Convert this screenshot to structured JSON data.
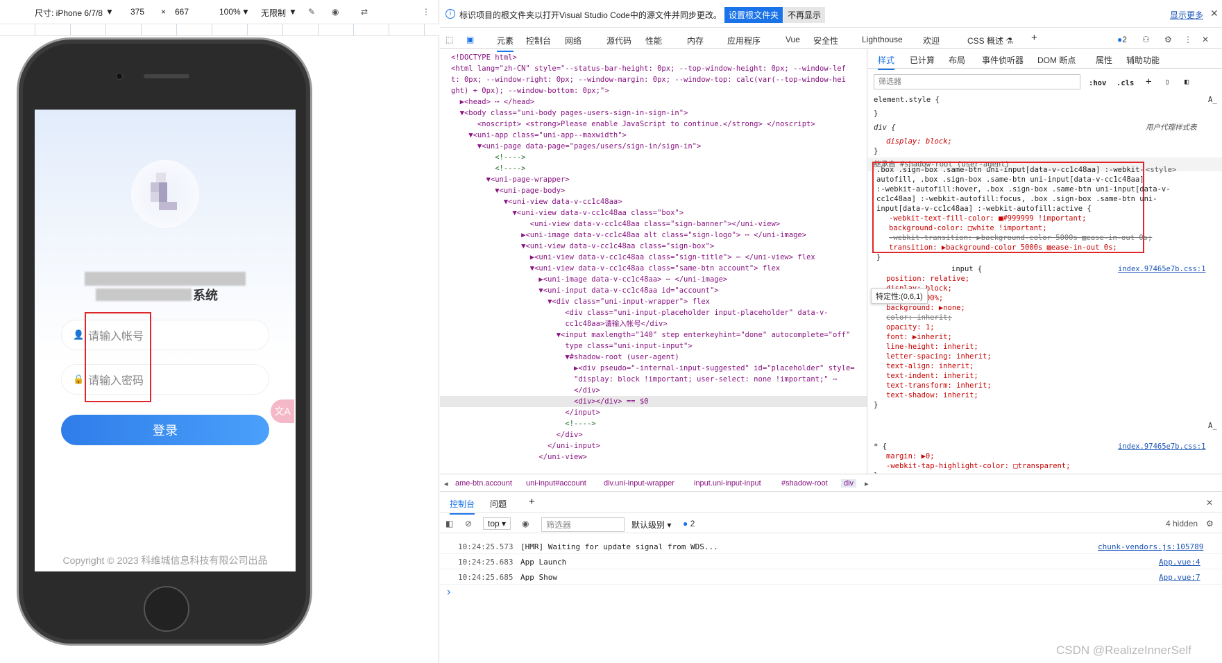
{
  "device_toolbar": {
    "size_label": "尺寸: iPhone 6/7/8",
    "width": "375",
    "times": "×",
    "height": "667",
    "zoom": "100%",
    "throttle": "无限制"
  },
  "app": {
    "system_suffix": "系统",
    "account_placeholder": "请输入帐号",
    "password_placeholder": "请输入密码",
    "login_label": "登录",
    "copyright": "Copyright © 2023 科维城信息科技有限公司出品",
    "translate_label": "文A"
  },
  "infobar": {
    "icon": "i",
    "message": "标识项目的根文件夹以打开Visual Studio Code中的源文件并同步更改。",
    "set_root_button": "设置根文件夹",
    "dismiss_button": "不再显示",
    "show_more": "显示更多",
    "close": "✕"
  },
  "devtools_tabs": [
    "元素",
    "控制台",
    "网络",
    "源代码",
    "性能",
    "内存",
    "应用程序",
    "Vue",
    "安全性",
    "Lighthouse",
    "欢迎",
    "CSS 概述 ⚗"
  ],
  "issues_count": "2",
  "dom_lines": [
    "<!DOCTYPE html>",
    "<html lang=\"zh-CN\" style=\"--status-bar-height: 0px; --top-window-height: 0px; --window-lef",
    "t: 0px; --window-right: 0px; --window-margin: 0px; --window-top: calc(var(--top-window-hei",
    "ght) + 0px); --window-bottom: 0px;\">",
    "  ▶<head> ⋯ </head>",
    "  ▼<body class=\"uni-body pages-users-sign-in-sign-in\">",
    "      <noscript> <strong>Please enable JavaScript to continue.</strong> </noscript>",
    "    ▼<uni-app class=\"uni-app--maxwidth\">",
    "      ▼<uni-page data-page=\"pages/users/sign-in/sign-in\">",
    "          <!---->",
    "          <!---->",
    "        ▼<uni-page-wrapper>",
    "          ▼<uni-page-body>",
    "            ▼<uni-view data-v-cc1c48aa>",
    "              ▼<uni-view data-v-cc1c48aa class=\"box\">",
    "                  <uni-view data-v-cc1c48aa class=\"sign-banner\"></uni-view>",
    "                ▶<uni-image data-v-cc1c48aa alt class=\"sign-logo\"> ⋯ </uni-image>",
    "                ▼<uni-view data-v-cc1c48aa class=\"sign-box\">",
    "                  ▶<uni-view data-v-cc1c48aa class=\"sign-title\"> ⋯ </uni-view> flex",
    "                  ▼<uni-view data-v-cc1c48aa class=\"same-btn account\"> flex",
    "                    ▶<uni-image data-v-cc1c48aa> ⋯ </uni-image>",
    "                    ▼<uni-input data-v-cc1c48aa id=\"account\">",
    "                      ▼<div class=\"uni-input-wrapper\"> flex",
    "                          <div class=\"uni-input-placeholder input-placeholder\" data-v-",
    "                          cc1c48aa>请输入帐号</div>",
    "                        ▼<input maxlength=\"140\" step enterkeyhint=\"done\" autocomplete=\"off\"",
    "                          type class=\"uni-input-input\">",
    "                          ▼#shadow-root (user-agent)",
    "                            ▶<div pseudo=\"-internal-input-suggested\" id=\"placeholder\" style=",
    "                            \"display: block !important; user-select: none !important;\" ⋯",
    "                            </div>",
    "                            <div></div> == $0",
    "                          </input>",
    "                          <!---->",
    "                        </div>",
    "                      </uni-input>",
    "                    </uni-view>"
  ],
  "style_tabs": [
    "样式",
    "已计算",
    "布局",
    "事件侦听器",
    "DOM 断点",
    "属性",
    "辅助功能"
  ],
  "styles": {
    "filter_placeholder": "筛选器",
    "hov": ":hov",
    "cls": ".cls",
    "element_style": "element.style {",
    "close_brace": "}",
    "div_selector": "div {",
    "ua_label": "用户代理样式表",
    "div_display": "display: block;",
    "inherited": "继承自 #shadow-root (user-agent)",
    "autofill_selector": [
      ".box .sign-box .same-btn uni-input[data-v-cc1c48aa] :-webkit-",
      "autofill, .box .sign-box .same-btn uni-input[data-v-cc1c48aa]",
      ":-webkit-autofill:hover, .box .sign-box .same-btn uni-input[data-v-",
      "cc1c48aa] :-webkit-autofill:focus, .box .sign-box .same-btn uni-",
      "input[data-v-cc1c48aa] :-webkit-autofill:active {"
    ],
    "style_link": "<style>",
    "autofill_props": [
      "-webkit-text-fill-color: ■#999999 !important;",
      "background-color: □white !important;",
      "-webkit-transition: ▶background-color 5000s ▨ease-in-out 0s;",
      "transition: ▶background-color 5000s ▨ease-in-out 0s;"
    ],
    "specificity_tip": "特定性:(0,6,1)",
    "input_selector": "input {",
    "input_link": "index.97465e7b.css:1",
    "input_props": [
      "position: relative;",
      "display: block;",
      "height: 100%;",
      "background: ▶none;",
      "color: inherit;",
      "opacity: 1;",
      "font: ▶inherit;",
      "line-height: inherit;",
      "letter-spacing: inherit;",
      "text-align: inherit;",
      "text-indent: inherit;",
      "text-transform: inherit;",
      "text-shadow: inherit;"
    ],
    "star_selector": "* {",
    "star_link": "index.97465e7b.css:1",
    "star_props": [
      "margin: ▶0;",
      "-webkit-tap-highlight-color: □transparent;"
    ]
  },
  "breadcrumbs": [
    "ame-btn.account",
    "uni-input#account",
    "div.uni-input-wrapper",
    "input.uni-input-input",
    "#shadow-root",
    "div"
  ],
  "console": {
    "tab_console": "控制台",
    "tab_issues": "问题",
    "context": "top",
    "filter_placeholder": "筛选器",
    "level": "默认级别 ▾",
    "issues": "2",
    "hidden": "4 hidden",
    "logs": [
      {
        "time": "10:24:25.573",
        "msg": "[HMR] Waiting for update signal from WDS...",
        "src": "chunk-vendors.js:105789"
      },
      {
        "time": "10:24:25.683",
        "msg": "App Launch",
        "src": "App.vue:4"
      },
      {
        "time": "10:24:25.685",
        "msg": "App Show",
        "src": "App.vue:7"
      }
    ],
    "prompt": "›"
  },
  "watermark": "CSDN @RealizeInnerSelf"
}
